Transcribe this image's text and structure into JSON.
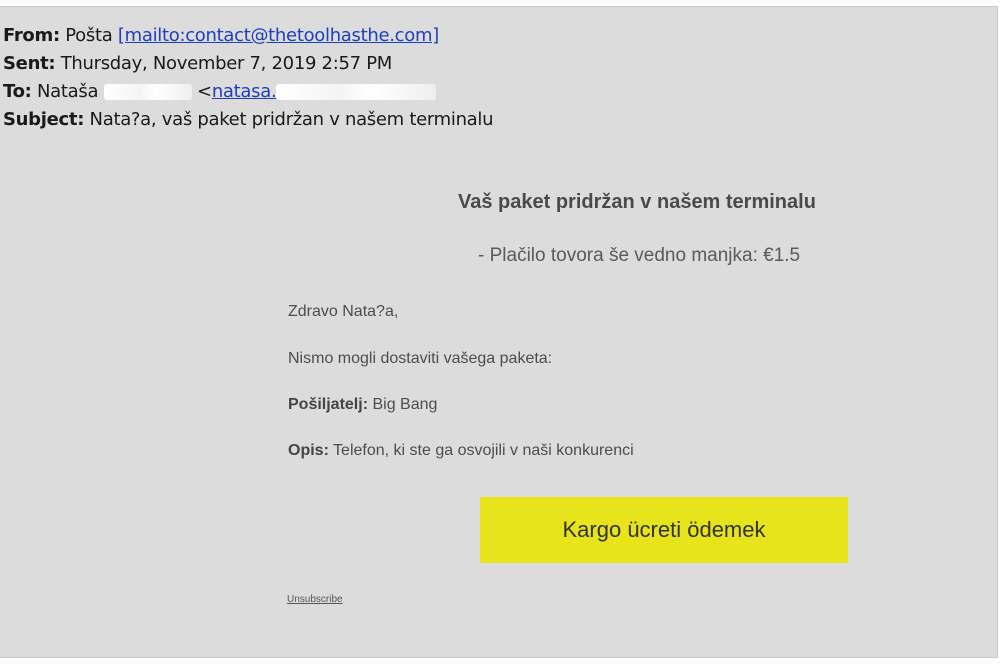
{
  "headers": {
    "from_label": "From:",
    "from_name": "Pošta",
    "from_link": "[mailto:contact@thetoolhasthe.com]",
    "sent_label": "Sent:",
    "sent_value": "Thursday, November 7, 2019 2:57 PM",
    "to_label": "To:",
    "to_name": "Nataša",
    "to_bracket": "<",
    "to_link": "natasa.",
    "subject_label": "Subject:",
    "subject_value": "Nata?a, vaš paket pridržan v našem terminalu"
  },
  "message": {
    "title": "Vaš paket pridržan v našem terminalu",
    "subtitle": "- Plačilo tovora še vedno manjka: €1.5",
    "greeting": "Zdravo Nata?a,",
    "intro": "Nismo mogli dostaviti vašega paketa:",
    "sender_label": "Pošiljatelj:",
    "sender_value": " Big Bang",
    "desc_label": "Opis:",
    "desc_value": " Telefon, ki ste ga osvojili v naši konkurenci",
    "cta_label": "Kargo ücreti ödemek",
    "unsubscribe": "Unsubscribe"
  },
  "colors": {
    "background": "#dcdcdc",
    "cta": "#e8e41b",
    "link": "#1f3fb8"
  }
}
